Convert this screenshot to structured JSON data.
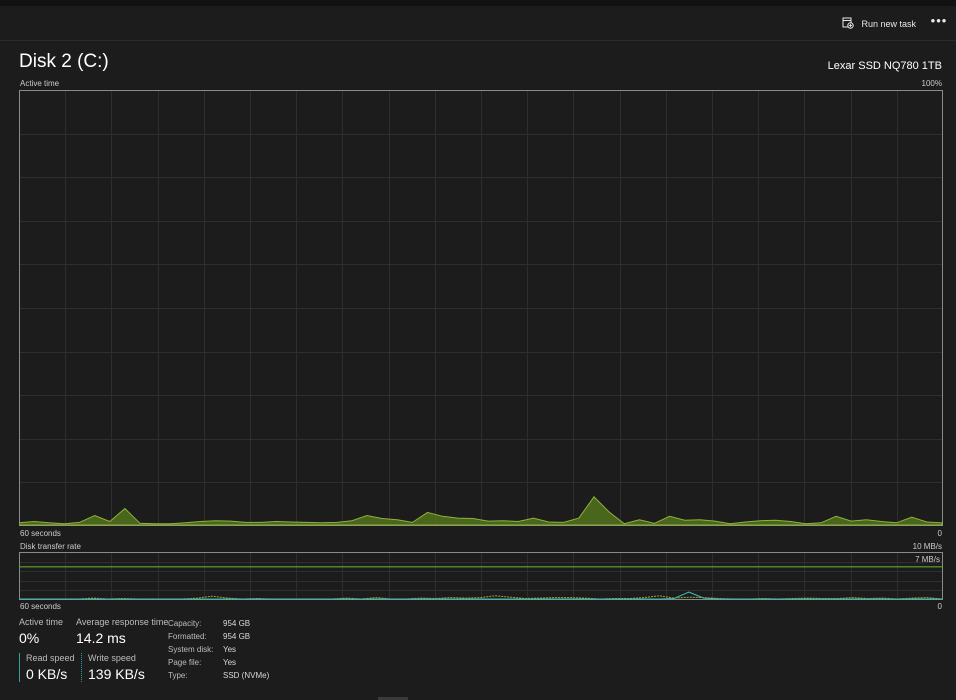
{
  "toolbar": {
    "run_new_task": "Run new task",
    "more": "•••"
  },
  "header": {
    "title": "Disk 2 (C:)",
    "model": "Lexar SSD NQ780 1TB"
  },
  "active_graph": {
    "label": "Active time",
    "max_label": "100%",
    "time_label": "60 seconds",
    "min_label": "0",
    "color": "#5a7d1c",
    "values": [
      0.5,
      0.8,
      0.5,
      0.3,
      0.6,
      2.2,
      0.8,
      3.8,
      0.4,
      0.3,
      0.3,
      0.5,
      0.8,
      1.0,
      0.9,
      0.6,
      0.6,
      0.8,
      0.7,
      0.6,
      0.5,
      0.6,
      1.0,
      2.2,
      1.5,
      1.2,
      0.6,
      2.9,
      2.0,
      1.6,
      1.5,
      0.9,
      1.0,
      0.8,
      1.6,
      0.7,
      0.6,
      1.6,
      6.5,
      3.0,
      0.3,
      1.2,
      0.4,
      2.0,
      1.1,
      1.2,
      0.9,
      0.3,
      0.7,
      1.0,
      1.1,
      0.8,
      0.3,
      0.5,
      2.0,
      0.9,
      1.2,
      0.8,
      0.5,
      1.8,
      0.7,
      0.5
    ]
  },
  "transfer_graph": {
    "label": "Disk transfer rate",
    "max_label": "10 MB/s",
    "line_label": "7 MB/s",
    "time_label": "60 seconds",
    "min_label": "0",
    "read_color": "#3dbbb8",
    "write_color": "#8fb23a",
    "line_value": 7,
    "max_value": 10,
    "write_values": [
      0,
      0,
      0,
      0,
      0,
      0.2,
      0,
      0.1,
      0,
      0,
      0,
      0,
      0.2,
      0.6,
      0.2,
      0,
      0.1,
      0,
      0,
      0,
      0,
      0,
      0.2,
      0,
      0.3,
      0,
      0,
      0.2,
      0.1,
      0.3,
      0.2,
      0.3,
      0.7,
      0.4,
      0.1,
      0.2,
      0.3,
      0.3,
      0.2,
      0,
      0.1,
      0.1,
      0.3,
      0.7,
      0.2,
      0.4,
      0.3,
      0.1,
      0,
      0,
      0.1,
      0,
      0.1,
      0.2,
      0.1,
      0.1,
      0.3,
      0.1,
      0.2,
      0,
      0.2,
      0.3,
      0
    ],
    "read_values": [
      0,
      0,
      0,
      0,
      0,
      0,
      0,
      0,
      0,
      0,
      0,
      0,
      0,
      0,
      0,
      0,
      0,
      0,
      0,
      0,
      0,
      0,
      0,
      0,
      0,
      0,
      0,
      0,
      0,
      0,
      0,
      0,
      0,
      0,
      0,
      0,
      0,
      0,
      0,
      0,
      0,
      0,
      0,
      0,
      0.1,
      1.5,
      0.2,
      0,
      0,
      0,
      0,
      0,
      0,
      0,
      0,
      0,
      0,
      0,
      0,
      0,
      0,
      0,
      0
    ]
  },
  "stats": {
    "active_time": {
      "label": "Active time",
      "value": "0%"
    },
    "avg_response": {
      "label": "Average response time",
      "value": "14.2 ms"
    },
    "read_speed": {
      "label": "Read speed",
      "value": "0 KB/s"
    },
    "write_speed": {
      "label": "Write speed",
      "value": "139 KB/s"
    }
  },
  "properties": [
    {
      "key": "Capacity:",
      "value": "954 GB"
    },
    {
      "key": "Formatted:",
      "value": "954 GB"
    },
    {
      "key": "System disk:",
      "value": "Yes"
    },
    {
      "key": "Page file:",
      "value": "Yes"
    },
    {
      "key": "Type:",
      "value": "SSD (NVMe)"
    }
  ]
}
